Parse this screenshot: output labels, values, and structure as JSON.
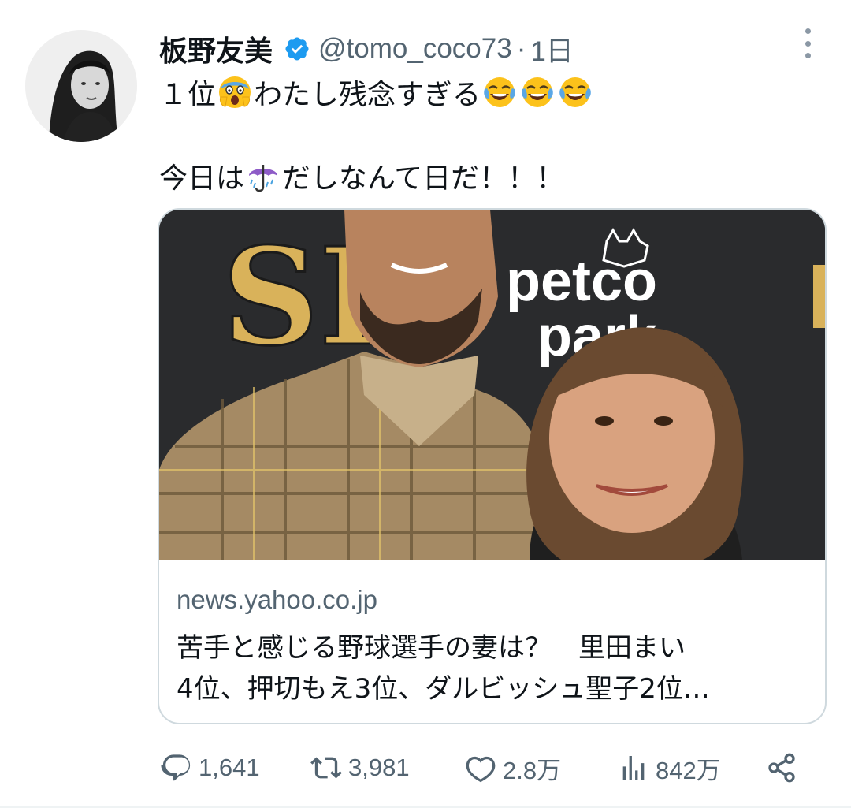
{
  "author": {
    "display_name": "板野友美",
    "handle": "@tomo_coco73",
    "separator": "·",
    "time": "1日",
    "verified": true,
    "verified_color": "#1d9bf0"
  },
  "tweet": {
    "line1_text_a": "１位",
    "line1_emoji_a": "screaming-face",
    "line1_text_b": "わたし残念すぎる",
    "line1_emoji_b": [
      "face-with-tears-of-joy",
      "face-with-tears-of-joy",
      "face-with-tears-of-joy"
    ],
    "line2_text_a": "今日は",
    "line2_emoji": "umbrella-with-rain",
    "line2_text_b": "だしなんて日だ！！！"
  },
  "card": {
    "domain": "news.yahoo.co.jp",
    "title_line1": "苦手と感じる野球選手の妻は？　里田まい",
    "title_line2": "4位、押切もえ3位、ダルビッシュ聖子2位…",
    "image_text": {
      "team_logo": "SD",
      "sponsor_line1": "petco",
      "sponsor_line2": "park"
    }
  },
  "actions": {
    "replies": "1,641",
    "retweets": "3,981",
    "likes": "2.8万",
    "views": "842万"
  },
  "colors": {
    "text_primary": "#0f1419",
    "text_secondary": "#536471",
    "border": "#cfd9de",
    "padres_gold": "#d9b25a"
  }
}
